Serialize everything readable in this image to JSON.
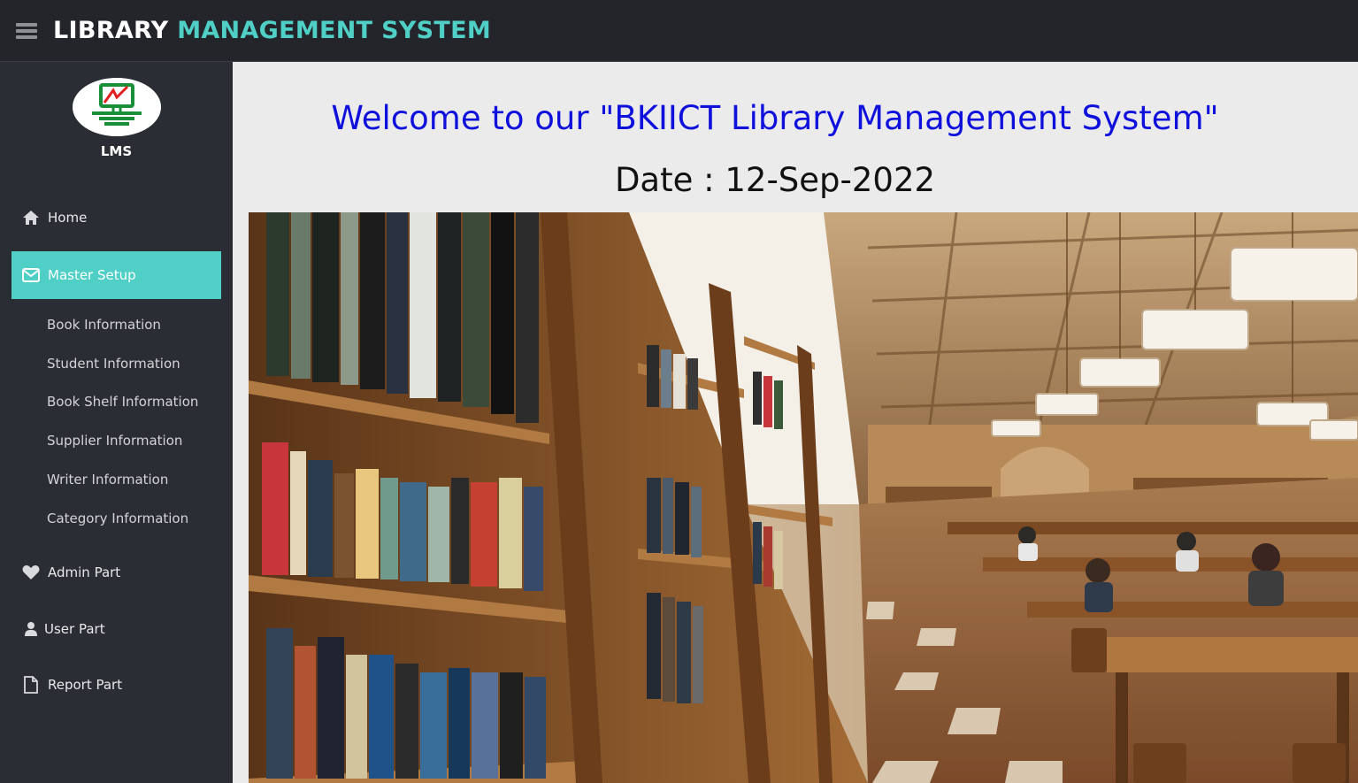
{
  "header": {
    "menu_icon": "hamburger-icon",
    "title_part1": "LIBRARY",
    "title_part2": "MANAGEMENT SYSTEM"
  },
  "sidebar": {
    "logo_text": "LMS",
    "items": [
      {
        "label": "Home",
        "icon": "home-icon"
      },
      {
        "label": "Master Setup",
        "icon": "envelope-icon",
        "active": true
      },
      {
        "label": "Admin Part",
        "icon": "heart-icon"
      },
      {
        "label": "User Part",
        "icon": "user-icon"
      },
      {
        "label": "Report Part",
        "icon": "document-icon"
      }
    ],
    "submenu": [
      "Book Information",
      "Student Information",
      "Book Shelf Information",
      "Supplier Information",
      "Writer Information",
      "Category Information"
    ]
  },
  "main": {
    "welcome": "Welcome to our \"BKIICT Library Management System\"",
    "date_label": "Date : 12-Sep-2022"
  },
  "colors": {
    "accent": "#4fcfc6",
    "topbar": "#23252b",
    "sidebar": "#2a2d33",
    "welcome_text": "#1010dd"
  }
}
